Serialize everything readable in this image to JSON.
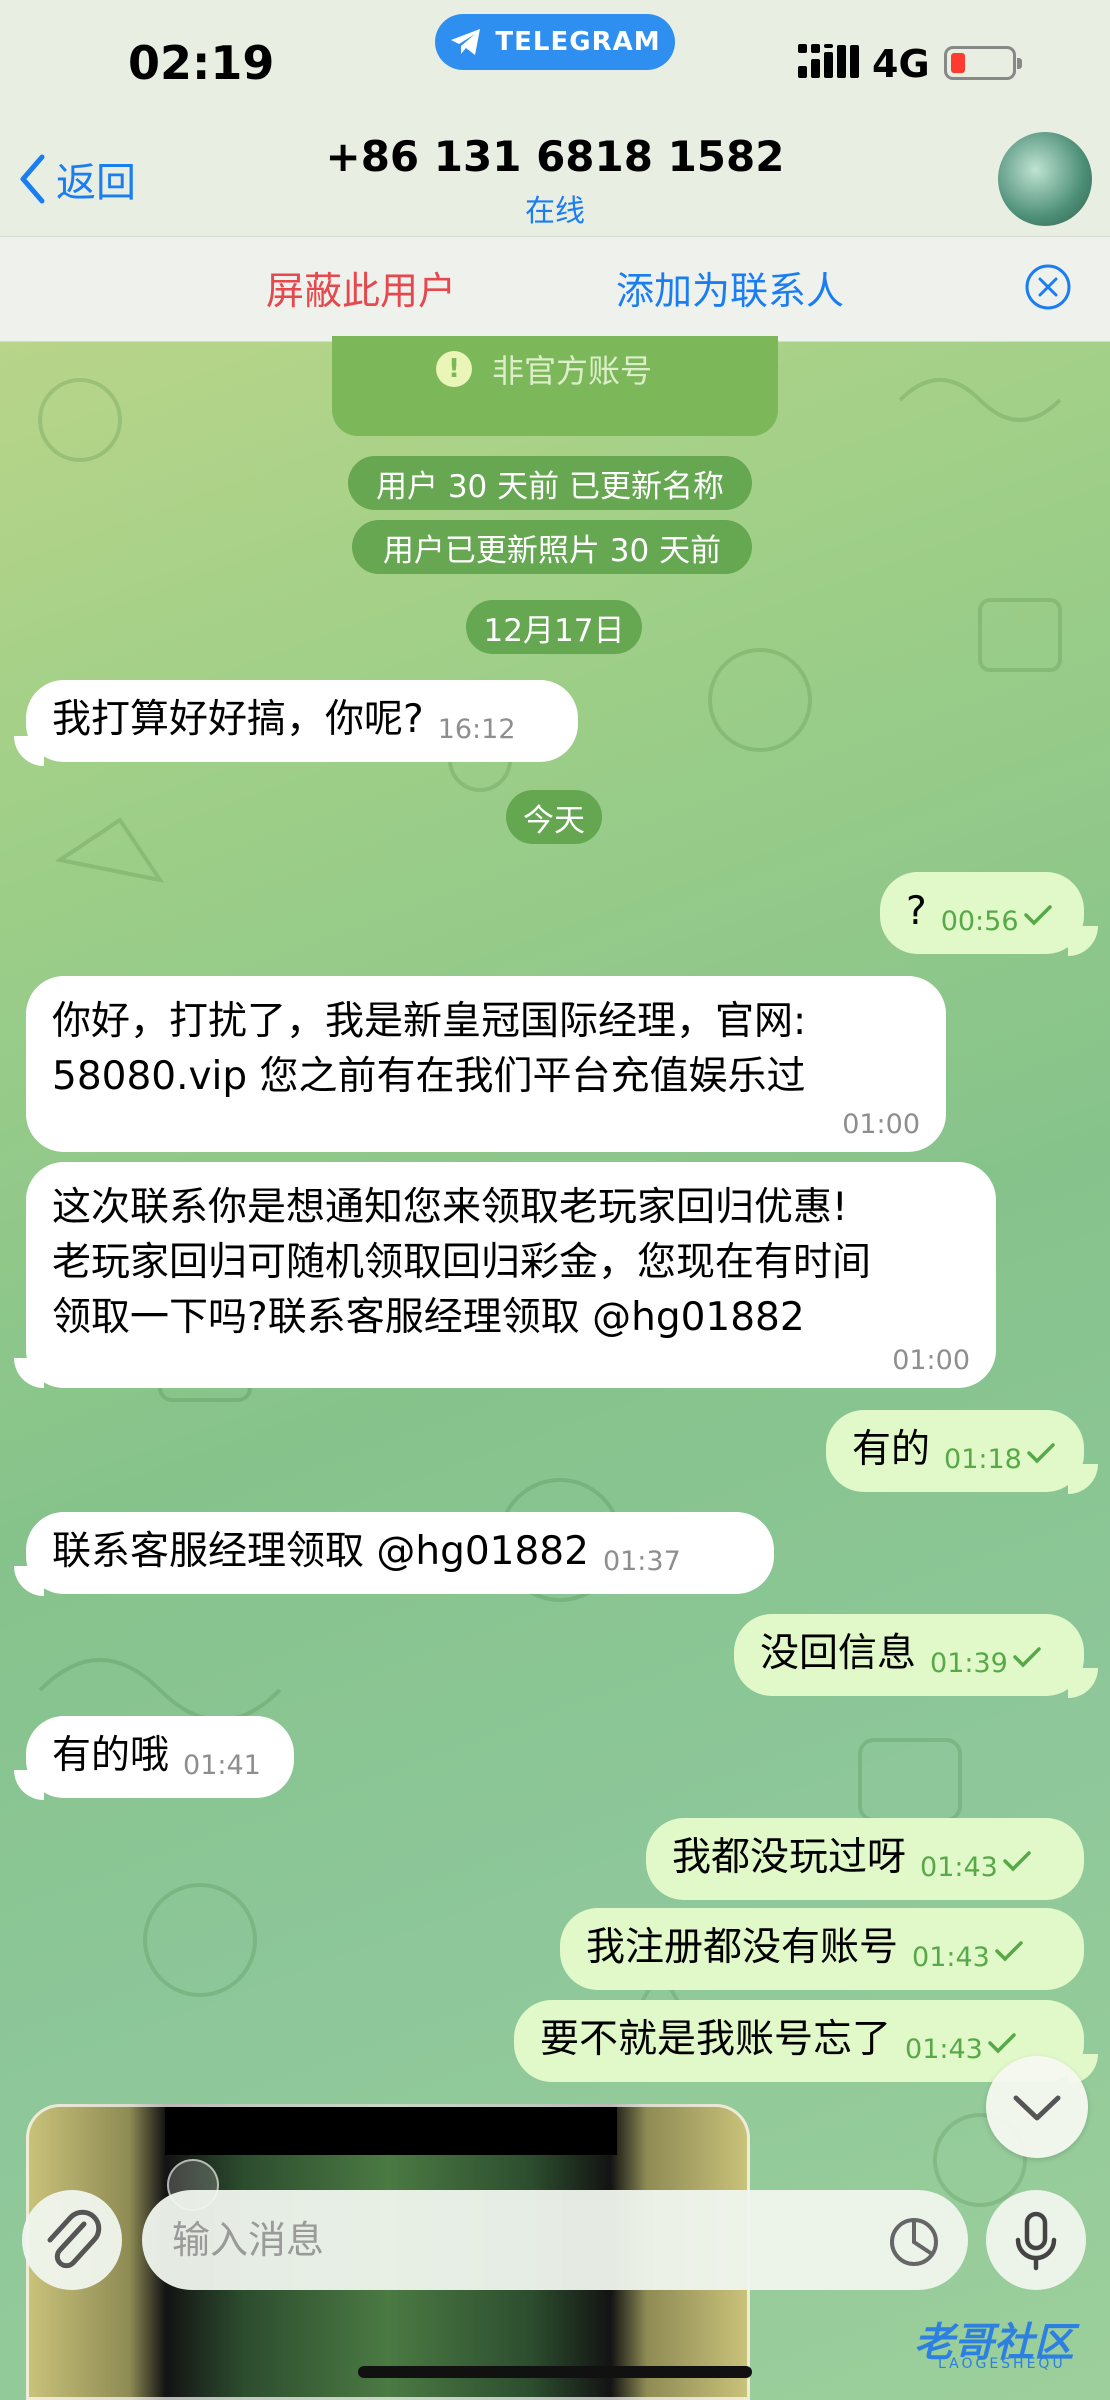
{
  "status_bar": {
    "time": "02:19",
    "app_pill": "TELEGRAM",
    "network": "4G",
    "battery_level": 0.1
  },
  "nav": {
    "back_label": "返回",
    "contact_name": "+86 131 6818 1582",
    "contact_status": "在线"
  },
  "actions": {
    "block": "屏蔽此用户",
    "add_contact": "添加为联系人"
  },
  "notice": {
    "unofficial": "非官方账号"
  },
  "service": {
    "name_updated": "用户 30 天前 已更新名称",
    "photo_updated": "用户已更新照片 30 天前"
  },
  "dates": {
    "first": "12月17日",
    "today": "今天"
  },
  "messages": [
    {
      "dir": "in",
      "text": "我打算好好搞，你呢?",
      "time": "16:12"
    },
    {
      "dir": "out",
      "text": "?",
      "time": "00:56"
    },
    {
      "dir": "in",
      "line1": "你好，打扰了，我是新皇冠国际经理，官网:",
      "line2": "58080.vip   您之前有在我们平台充值娱乐过",
      "time": "01:00"
    },
    {
      "dir": "in",
      "line1": "这次联系你是想通知您来领取老玩家回归优惠!",
      "line2": "老玩家回归可随机领取回归彩金，您现在有时间",
      "line3": "领取一下吗?联系客服经理领取    @hg01882",
      "time": "01:00"
    },
    {
      "dir": "out",
      "text": "有的",
      "time": "01:18"
    },
    {
      "dir": "in",
      "text": "联系客服经理领取    @hg01882",
      "time": "01:37"
    },
    {
      "dir": "out",
      "text": "没回信息",
      "time": "01:39"
    },
    {
      "dir": "in",
      "text": "有的哦",
      "time": "01:41"
    },
    {
      "dir": "out",
      "text": "我都没玩过呀",
      "time": "01:43"
    },
    {
      "dir": "out",
      "text": "我注册都没有账号",
      "time": "01:43"
    },
    {
      "dir": "out",
      "text": "要不就是我账号忘了",
      "time": "01:43"
    }
  ],
  "composer": {
    "placeholder": "输入消息"
  },
  "watermark": {
    "text": "老哥社区",
    "sub": "LAOGESHEQU"
  },
  "colors": {
    "accent_blue": "#1a7ef2",
    "danger_red": "#e5484d",
    "outgoing_bubble": "#e1f8c9",
    "incoming_bubble": "#ffffff",
    "check_green": "#57a947"
  }
}
